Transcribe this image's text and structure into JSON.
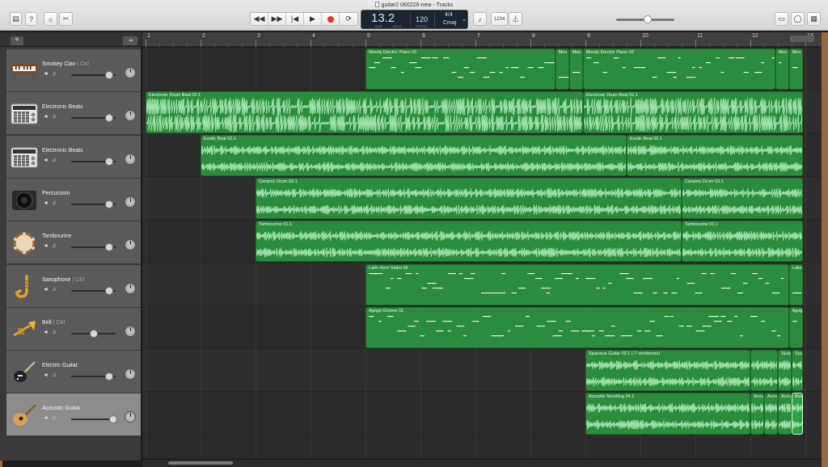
{
  "window": {
    "title": "guitar2 060226-new - Tracks"
  },
  "toolbar": {
    "library_icon": "library-icon",
    "help_icon": "help-icon",
    "smart_controls_icon": "smart-controls-icon",
    "editors_icon": "scissors-icon",
    "transport": [
      "rewind-icon",
      "fast-forward-icon",
      "go-to-beginning-icon",
      "play-icon",
      "record-icon",
      "cycle-icon"
    ],
    "count_in": "1234",
    "tuner_icon": "tuner-icon",
    "metronome_icon": "metronome-icon",
    "notepad_icon": "notepad-icon",
    "loop_browser_icon": "loop-icon",
    "media_browser_icon": "media-icon"
  },
  "lcd": {
    "position": "13.2",
    "bar_label": "BAR",
    "beat_label": "BEAT",
    "tempo": "120",
    "tempo_label": "TEMPO",
    "time_sig": "4/4",
    "key": "Cmaj"
  },
  "ruler": {
    "numbers": [
      "1",
      "2",
      "3",
      "4",
      "5",
      "6",
      "7",
      "8",
      "9",
      "10",
      "11",
      "12",
      "13"
    ]
  },
  "tracks": [
    {
      "name": "Smokey Clav",
      "sub": "Ctrl",
      "icon": "keyboard-icon",
      "volume": 0.85
    },
    {
      "name": "Electronic Beats",
      "sub": "",
      "icon": "drum-machine-icon",
      "volume": 0.85
    },
    {
      "name": "Electronic Beats",
      "sub": "",
      "icon": "drum-machine-icon",
      "volume": 0.85
    },
    {
      "name": "Percussion",
      "sub": "",
      "icon": "speaker-icon",
      "volume": 0.85
    },
    {
      "name": "Tambourine",
      "sub": "",
      "icon": "tambourine-icon",
      "volume": 0.85
    },
    {
      "name": "Saxophone",
      "sub": "Ctrl",
      "icon": "saxophone-icon",
      "volume": 0.85
    },
    {
      "name": "Bell",
      "sub": "Ctrl",
      "icon": "trumpet-icon",
      "volume": 0.5
    },
    {
      "name": "Electric Guitar",
      "sub": "",
      "icon": "electric-guitar-icon",
      "volume": 0.85
    },
    {
      "name": "Acoustic Guitar",
      "sub": "",
      "icon": "acoustic-guitar-icon",
      "volume": 0.95,
      "selected": true
    }
  ],
  "regions": [
    {
      "lane": 0,
      "label": "Moody Electric Piano 02",
      "start": 5,
      "end": 8.45,
      "kind": "midi"
    },
    {
      "lane": 0,
      "label": "Moo",
      "start": 8.45,
      "end": 8.7,
      "kind": "midi"
    },
    {
      "lane": 0,
      "label": "Moo",
      "start": 8.7,
      "end": 8.95,
      "kind": "midi"
    },
    {
      "lane": 0,
      "label": "Moody Electric Piano 02",
      "start": 8.95,
      "end": 12.45,
      "kind": "midi"
    },
    {
      "lane": 0,
      "label": "Moo",
      "start": 12.45,
      "end": 12.7,
      "kind": "midi"
    },
    {
      "lane": 0,
      "label": "Moo",
      "start": 12.7,
      "end": 12.95,
      "kind": "midi"
    },
    {
      "lane": 1,
      "label": "Electronic Drum Beat 02.1",
      "start": 1,
      "end": 8.95,
      "kind": "drum"
    },
    {
      "lane": 1,
      "label": "Electronic Drum Beat 02.1",
      "start": 8.95,
      "end": 12.95,
      "kind": "drum"
    },
    {
      "lane": 2,
      "label": "Exotic Beat 02.1",
      "start": 2,
      "end": 9.75,
      "kind": "audio"
    },
    {
      "lane": 2,
      "label": "Exotic Beat 02.1",
      "start": 9.75,
      "end": 12.95,
      "kind": "audio"
    },
    {
      "lane": 3,
      "label": "Ceramic Drum 03.1",
      "start": 3,
      "end": 10.75,
      "kind": "audio"
    },
    {
      "lane": 3,
      "label": "Ceramic Drum 03.1",
      "start": 10.75,
      "end": 12.95,
      "kind": "audio"
    },
    {
      "lane": 4,
      "label": "Tambourine 01.1",
      "start": 3,
      "end": 10.75,
      "kind": "audio"
    },
    {
      "lane": 4,
      "label": "Tambourine 01.1",
      "start": 10.75,
      "end": 12.95,
      "kind": "audio"
    },
    {
      "lane": 5,
      "label": "Latin Horn Stabs 06",
      "start": 5,
      "end": 12.7,
      "kind": "midi"
    },
    {
      "lane": 5,
      "label": "Latin",
      "start": 12.7,
      "end": 12.95,
      "kind": "midi"
    },
    {
      "lane": 6,
      "label": "Agogo Groove 01",
      "start": 5,
      "end": 12.7,
      "kind": "midi"
    },
    {
      "lane": 6,
      "label": "Agog",
      "start": 12.7,
      "end": 12.95,
      "kind": "midi"
    },
    {
      "lane": 7,
      "label": "Spacious Guitar 02.1 (-7 semitones)",
      "start": 9,
      "end": 12.0,
      "kind": "audio"
    },
    {
      "lane": 7,
      "label": "",
      "start": 12.0,
      "end": 12.5,
      "kind": "audio"
    },
    {
      "lane": 7,
      "label": "Spac",
      "start": 12.5,
      "end": 12.75,
      "kind": "audio"
    },
    {
      "lane": 7,
      "label": "Spac",
      "start": 12.75,
      "end": 12.95,
      "kind": "audio"
    },
    {
      "lane": 8,
      "label": "Acoustic Noodling 04.1",
      "start": 9,
      "end": 12.0,
      "kind": "audio"
    },
    {
      "lane": 8,
      "label": "Acou",
      "start": 12.0,
      "end": 12.25,
      "kind": "audio"
    },
    {
      "lane": 8,
      "label": "Acou",
      "start": 12.25,
      "end": 12.5,
      "kind": "audio"
    },
    {
      "lane": 8,
      "label": "Acou",
      "start": 12.5,
      "end": 12.75,
      "kind": "audio"
    },
    {
      "lane": 8,
      "label": "Acou",
      "start": 12.75,
      "end": 12.95,
      "kind": "audio",
      "selected": true
    }
  ],
  "colors": {
    "region": "#2a8c3c",
    "region_border": "#1e6b2d",
    "record": "#e23b2e"
  }
}
